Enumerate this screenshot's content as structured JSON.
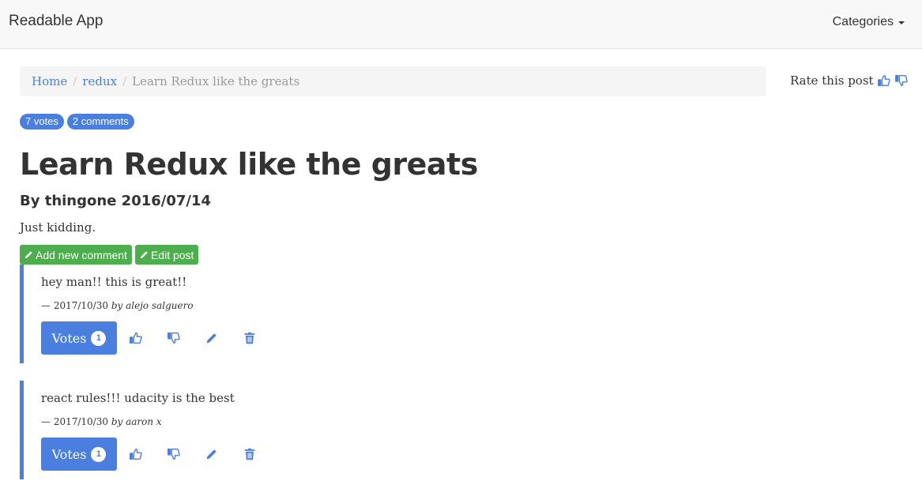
{
  "navbar": {
    "brand": "Readable App",
    "categories_label": "Categories"
  },
  "breadcrumb": {
    "home": "Home",
    "category": "redux",
    "current": "Learn Redux like the greats"
  },
  "rate": {
    "label": "Rate this post"
  },
  "badges": {
    "votes": "7 votes",
    "comments": "2 comments"
  },
  "post": {
    "title": "Learn Redux like the greats",
    "meta": "By thingone 2016/07/14",
    "body": "Just kidding."
  },
  "actions": {
    "add_comment": "Add new comment",
    "edit_post": "Edit post"
  },
  "comments": [
    {
      "body": "hey man!! this is great!!",
      "date": "2017/10/30",
      "by": "by alejo salguero",
      "votes_label": "Votes",
      "vote_count": "1"
    },
    {
      "body": "react rules!!! udacity is the best",
      "date": "2017/10/30",
      "by": "by aaron x",
      "votes_label": "Votes",
      "vote_count": "1"
    }
  ],
  "colors": {
    "accent": "#4a7fe0",
    "success": "#4cae4c",
    "navbar_bg": "#f8f8f8"
  },
  "icons": [
    "thumbs-up-icon",
    "thumbs-down-icon",
    "pencil-icon",
    "trash-icon",
    "caret-down-icon"
  ]
}
